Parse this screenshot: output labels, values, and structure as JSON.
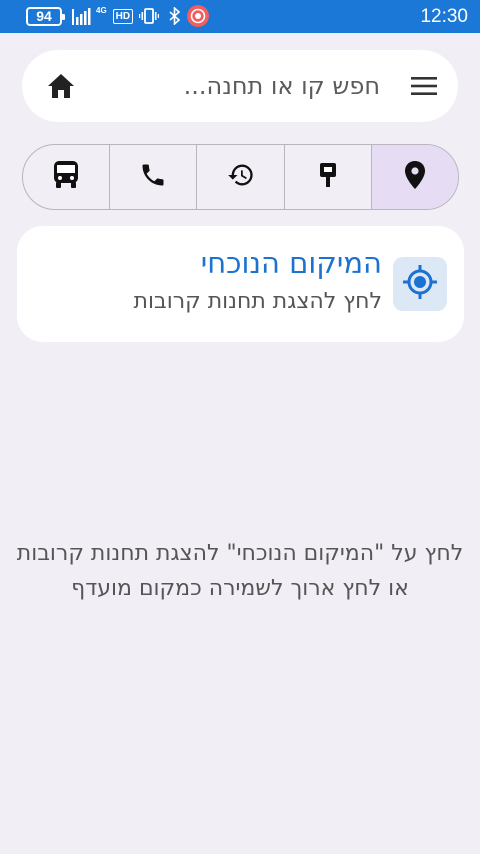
{
  "status_bar": {
    "battery": "94",
    "network": "4G",
    "hd": "HD",
    "time": "12:30"
  },
  "search": {
    "placeholder": "חפש קו או תחנה...",
    "left_icon": "home-icon",
    "right_icon": "menu-icon"
  },
  "tabs": [
    {
      "icon": "location-pin-icon",
      "active": true
    },
    {
      "icon": "bus-stop-sign-icon",
      "active": false
    },
    {
      "icon": "history-icon",
      "active": false
    },
    {
      "icon": "phone-icon",
      "active": false
    },
    {
      "icon": "bus-icon",
      "active": false
    }
  ],
  "location_card": {
    "title": "המיקום הנוכחי",
    "subtitle": "לחץ להצגת תחנות קרובות",
    "icon": "my-location-icon"
  },
  "hint": {
    "line1": "לחץ על \"המיקום הנוכחי\" להצגת תחנות קרובות",
    "line2": "או לחץ ארוך לשמירה כמקום מועדף"
  },
  "colors": {
    "status_bar": "#1c78d6",
    "background": "#f1eff5",
    "accent": "#1c72d1",
    "active_tab": "#e6dcf4"
  }
}
